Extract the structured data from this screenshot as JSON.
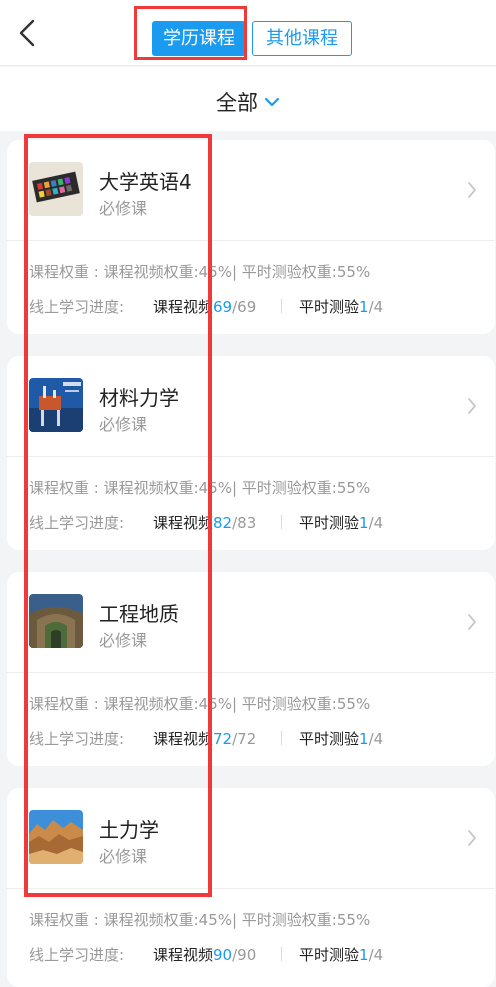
{
  "header": {
    "tabs": [
      {
        "label": "学历课程",
        "active": true
      },
      {
        "label": "其他课程",
        "active": false
      }
    ]
  },
  "filter": {
    "label": "全部"
  },
  "courses": [
    {
      "title": "大学英语4",
      "type": "必修课",
      "weight": "课程权重 : 课程视频权重:45%| 平时测验权重:55%",
      "progress_label": "线上学习进度:",
      "video_label": "课程视频",
      "video_done": "69",
      "video_total": "/69",
      "quiz_label": "平时测验",
      "quiz_done": "1",
      "quiz_total": "/4",
      "thumb_icon": "watercolor-paint-thumbnail"
    },
    {
      "title": "材料力学",
      "type": "必修课",
      "weight": "课程权重 : 课程视频权重:45%| 平时测验权重:55%",
      "progress_label": "线上学习进度:",
      "video_label": "课程视频",
      "video_done": "82",
      "video_total": "/83",
      "quiz_label": "平时测验",
      "quiz_done": "1",
      "quiz_total": "/4",
      "thumb_icon": "oil-platform-thumbnail"
    },
    {
      "title": "工程地质",
      "type": "必修课",
      "weight": "课程权重 : 课程视频权重:45%| 平时测验权重:55%",
      "progress_label": "线上学习进度:",
      "video_label": "课程视频",
      "video_done": "72",
      "video_total": "/72",
      "quiz_label": "平时测验",
      "quiz_done": "1",
      "quiz_total": "/4",
      "thumb_icon": "canyon-thumbnail"
    },
    {
      "title": "土力学",
      "type": "必修课",
      "weight": "课程权重 : 课程视频权重:45%| 平时测验权重:55%",
      "progress_label": "线上学习进度:",
      "video_label": "课程视频",
      "video_done": "90",
      "video_total": "/90",
      "quiz_label": "平时测验",
      "quiz_done": "1",
      "quiz_total": "/4",
      "thumb_icon": "rock-formation-thumbnail"
    }
  ],
  "colors": {
    "accent": "#1a9bf0",
    "highlight": "#ee3a3a"
  }
}
